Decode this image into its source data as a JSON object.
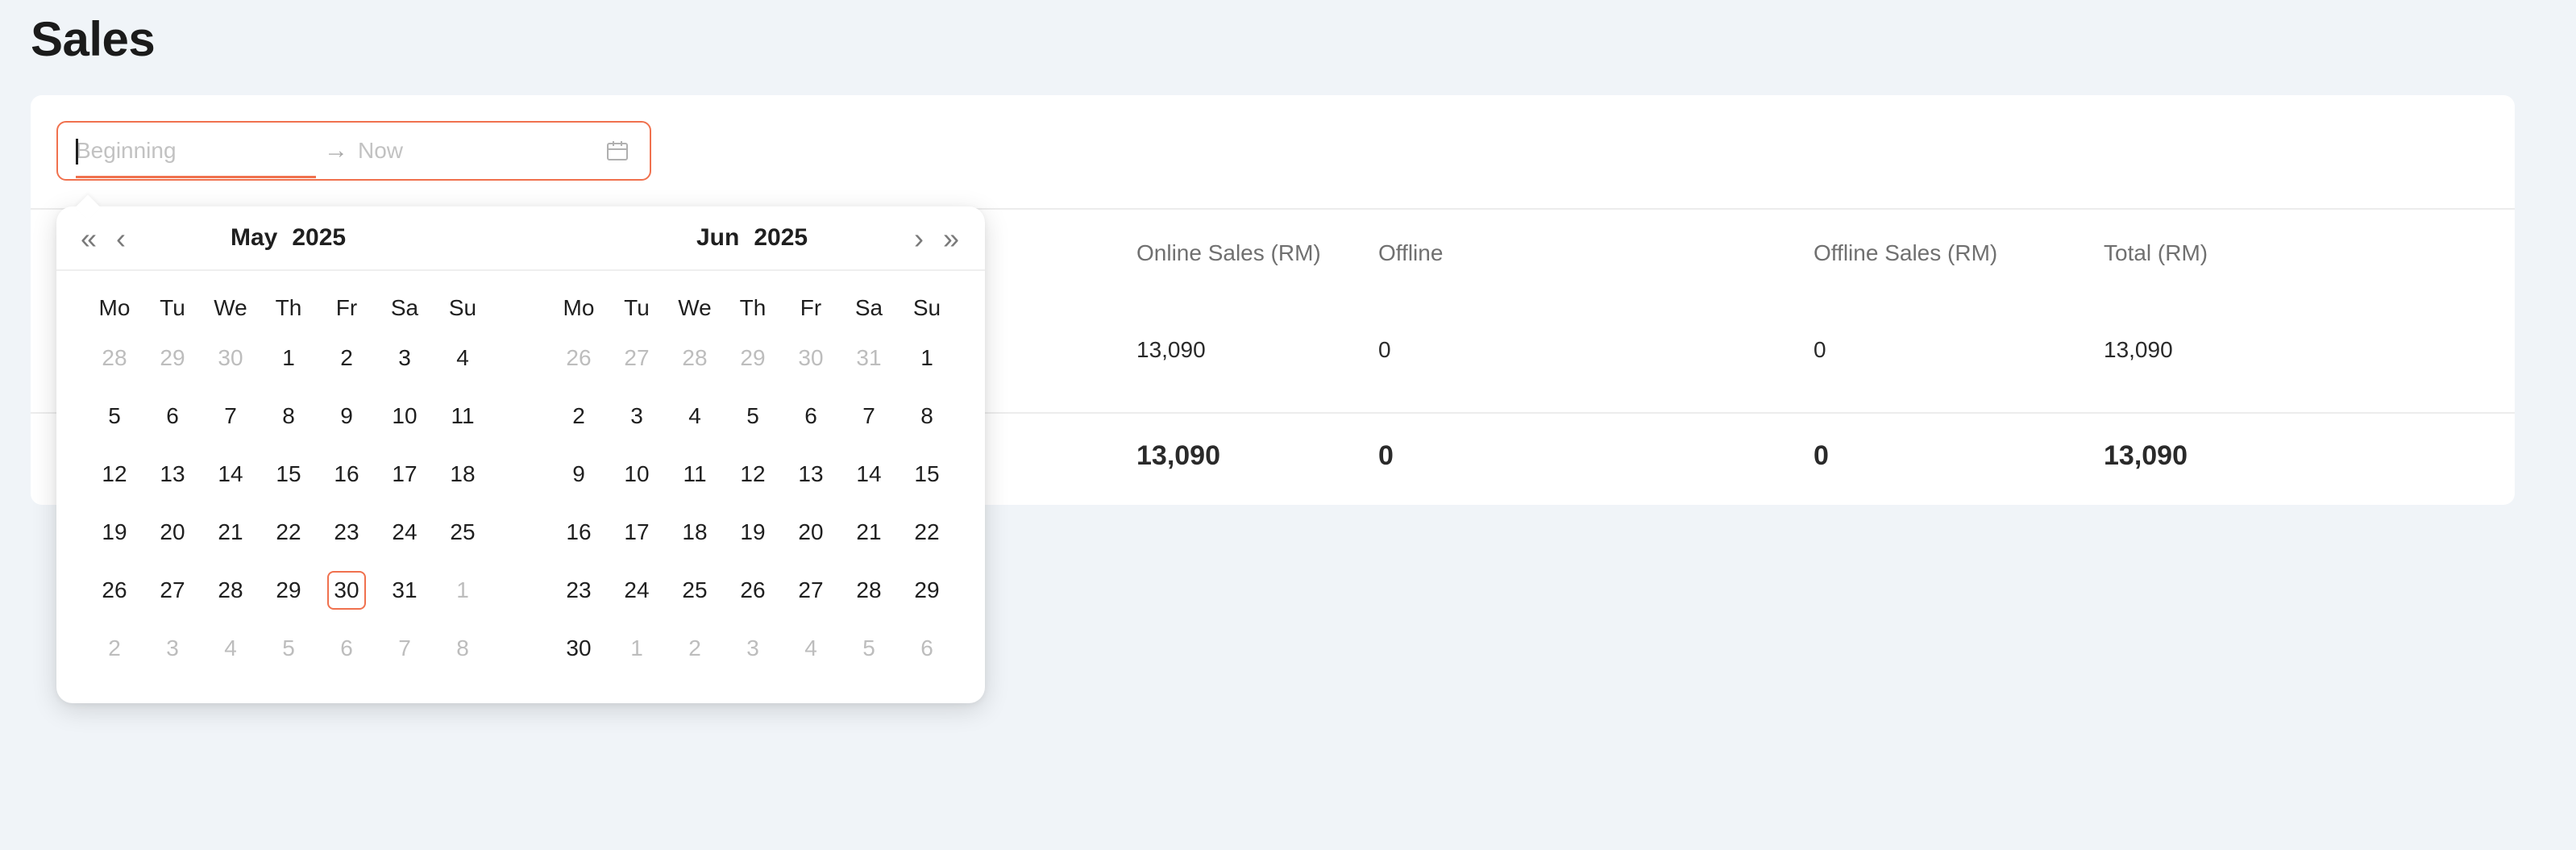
{
  "page": {
    "title": "Sales"
  },
  "date_range": {
    "start_placeholder": "Beginning",
    "end_placeholder": "Now",
    "separator": "→"
  },
  "table": {
    "headers": {
      "online_sales": "Online Sales (RM)",
      "offline": "Offline",
      "offline_sales": "Offline Sales (RM)",
      "total": "Total (RM)"
    },
    "row": {
      "online_sales": "13,090",
      "offline": "0",
      "offline_sales": "0",
      "total": "13,090"
    },
    "totals": {
      "online_sales": "13,090",
      "offline": "0",
      "offline_sales": "0",
      "total": "13,090"
    }
  },
  "calendar": {
    "nav": {
      "prev_year": "«",
      "prev_month": "‹",
      "next_month": "›",
      "next_year": "»"
    },
    "weekdays": [
      "Mo",
      "Tu",
      "We",
      "Th",
      "Fr",
      "Sa",
      "Su"
    ],
    "left": {
      "month": "May",
      "year": "2025",
      "days": [
        "28",
        "29",
        "30",
        "1",
        "2",
        "3",
        "4",
        "5",
        "6",
        "7",
        "8",
        "9",
        "10",
        "11",
        "12",
        "13",
        "14",
        "15",
        "16",
        "17",
        "18",
        "19",
        "20",
        "21",
        "22",
        "23",
        "24",
        "25",
        "26",
        "27",
        "28",
        "29",
        "30",
        "31",
        "1",
        "2",
        "3",
        "4",
        "5",
        "6",
        "7",
        "8"
      ],
      "in_month_start": 3,
      "in_month_end": 33,
      "today_index": 32
    },
    "right": {
      "month": "Jun",
      "year": "2025",
      "days": [
        "26",
        "27",
        "28",
        "29",
        "30",
        "31",
        "1",
        "2",
        "3",
        "4",
        "5",
        "6",
        "7",
        "8",
        "9",
        "10",
        "11",
        "12",
        "13",
        "14",
        "15",
        "16",
        "17",
        "18",
        "19",
        "20",
        "21",
        "22",
        "23",
        "24",
        "25",
        "26",
        "27",
        "28",
        "29",
        "30",
        "1",
        "2",
        "3",
        "4",
        "5",
        "6"
      ],
      "in_month_start": 6,
      "in_month_end": 35,
      "today_index": -1
    }
  },
  "colors": {
    "accent": "#f0714e",
    "background": "#f0f4f8",
    "muted_text": "#bdbdbd"
  }
}
